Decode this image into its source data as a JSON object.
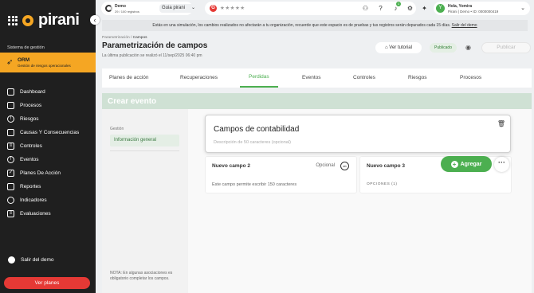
{
  "sidebar": {
    "logo_text": "pirani",
    "section_label": "Sistema de gestión",
    "module": {
      "title": "ORM",
      "subtitle": "Gestión de riesgos operacionales"
    },
    "items": [
      {
        "label": "Dashboard",
        "icon": "monitor-icon"
      },
      {
        "label": "Procesos",
        "icon": "folder-icon"
      },
      {
        "label": "Riesgos",
        "icon": "alert-icon"
      },
      {
        "label": "Causas Y Consecuencias",
        "icon": "cause-icon"
      },
      {
        "label": "Controles",
        "icon": "controls-icon"
      },
      {
        "label": "Eventos",
        "icon": "events-icon"
      },
      {
        "label": "Planes De Acción",
        "icon": "checklist-icon"
      },
      {
        "label": "Reportes",
        "icon": "reports-icon"
      },
      {
        "label": "Indicadores",
        "icon": "indicators-icon"
      },
      {
        "label": "Evaluaciones",
        "icon": "evaluations-icon"
      }
    ],
    "exit_demo": "Salir del demo",
    "plans_button": "Ver planes"
  },
  "topbar": {
    "demo_title": "Demo",
    "demo_sub": "29 / 100 registros",
    "guide_select": "Guia pirani",
    "rating_stars": "★★★★★",
    "notifications_count": "1",
    "user_initial": "Y",
    "user_name": "Hola, Yomira",
    "user_org": "Pirani | Demo • ID: 0000000419"
  },
  "notice": {
    "text": "Estás en una simulación, los cambios realizados no afectarán a tu organización, recuerde que este espacio es de pruebas y tus registros serán depurados cada 15 días.",
    "link": "Salir del demo"
  },
  "header": {
    "breadcrumb_parent": "Parametrización",
    "breadcrumb_current": "Campos",
    "title": "Parametrización de campos",
    "last_published": "La última publicación se realizó el 11/sep/2025 06:40 pm",
    "tutorial_button": "Ver tutorial",
    "status_badge": "Publicado",
    "publish_button": "Publicar"
  },
  "tabs": [
    "Planes de acción",
    "Recuperaciones",
    "Perdidas",
    "Eventos",
    "Controles",
    "Riesgos",
    "Procesos"
  ],
  "active_tab": "Perdidas",
  "card": {
    "title": "Crear evento",
    "group_label": "Gestión",
    "selected_group": "Información general",
    "note": "NOTA: En algunas asociaciones es obligatorio completar los campos."
  },
  "modal": {
    "title": "Campos de contabilidad",
    "description_placeholder": "Descripción de 50 caracteres (opcional)"
  },
  "fields": [
    {
      "name": "Nuevo campo 2",
      "optional": "Opcional",
      "help": "Este campo permite escribir 150 caracteres"
    },
    {
      "name": "Nuevo campo 3",
      "options": "OPCIONES (1)"
    }
  ],
  "add_button": "Agregar",
  "colors": {
    "accent": "#4caf50",
    "brand": "#f5a623",
    "danger": "#e53935",
    "sidebar": "#1f1f1f"
  }
}
